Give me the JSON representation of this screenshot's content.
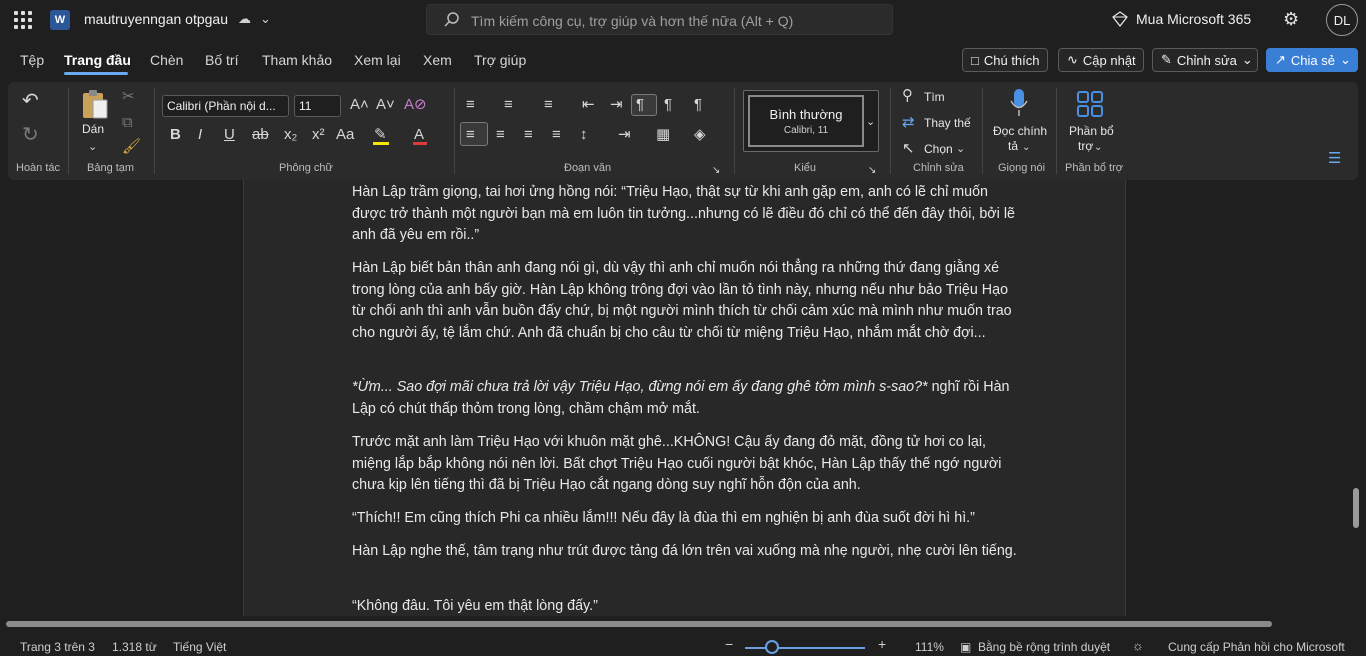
{
  "titlebar": {
    "doc_title": "mautruyenngan otpgau",
    "search_placeholder": "Tìm kiếm công cụ, trợ giúp và hơn thế nữa (Alt + Q)",
    "buy_label": "Mua Microsoft 365",
    "avatar_initials": "DL",
    "app_letter": "W"
  },
  "tabs": [
    "Tệp",
    "Trang đầu",
    "Chèn",
    "Bố trí",
    "Tham khảo",
    "Xem lại",
    "Xem",
    "Trợ giúp"
  ],
  "active_tab": "Trang đầu",
  "top_buttons": {
    "comments": "Chú thích",
    "update": "Cập nhật",
    "editing": "Chỉnh sửa",
    "share": "Chia sẻ"
  },
  "ribbon": {
    "groups": {
      "undo": "Hoàn tác",
      "clipboard": "Bảng tạm",
      "font": "Phông chữ",
      "paragraph": "Đoạn văn",
      "styles": "Kiểu",
      "editing": "Chỉnh sửa",
      "voice": "Giọng nói",
      "addins": "Phần bổ trợ"
    },
    "paste_label": "Dán",
    "font_name": "Calibri (Phần nội d...",
    "font_size": "11",
    "style_name": "Bình thường",
    "style_sub": "Calibri, 11",
    "find_label": "Tìm",
    "replace_label": "Thay thế",
    "select_label": "Chọn",
    "dictate_label_1": "Đọc chính",
    "dictate_label_2": "tả",
    "addins_label_1": "Phần bổ",
    "addins_label_2": "trợ"
  },
  "document": {
    "paragraphs": [
      "Hàn Lập trầm giọng, tai hơi ửng hồng nói: “Triệu Hạo, thật sự từ khi anh gặp em, anh có lẽ chỉ muốn được trở thành một người bạn mà em luôn tin tưởng...nhưng có lẽ điều đó chỉ có thể đến đây thôi, bởi lẽ anh đã yêu em rồi..”",
      "Hàn Lập biết bản thân anh đang nói gì, dù vậy thì anh chỉ muốn nói thẳng ra những thứ đang giằng xé trong lòng của anh bấy giờ. Hàn Lập không trông đợi vào lần tỏ tình này, nhưng nếu như bảo Triệu Hạo từ chối anh thì anh vẫn buồn đấy chứ, bị một người mình thích từ chối cảm xúc mà mình như muốn trao cho người ấy, tệ lắm chứ. Anh đã chuẩn bị cho câu từ chối từ miệng Triệu Hạo, nhắm mắt chờ đợi...",
      "Hàn Lập có chút thấp thỏm trong lòng, chầm chậm mở mắt.",
      "Trước mặt anh làm Triệu Hạo với khuôn mặt ghê...KHÔNG! Cậu ấy đang đỏ mặt, đồng tử hơi co lại, miệng lắp bắp không nói nên lời. Bất chợt Triệu Hạo cuối người bật khóc, Hàn Lập thấy thế ngớ người chưa kịp lên tiếng thì đã bị Triệu Hạo cắt ngang dòng suy nghĩ hỗn độn của anh.",
      "“Thích!! Em cũng thích Phi ca nhiều lắm!!! Nếu đây là đùa thì em nghiện bị anh đùa suốt đời hì hì.”",
      "Hàn Lập nghe thế, tâm trạng như trút được tảng đá lớn trên vai xuống mà nhẹ người, nhẹ cười lên tiếng.",
      "“Không đâu. Tôi yêu em thật lòng đấy.”"
    ],
    "italic_part": "*Ừm... Sao đợi mãi chưa trả lời vậy Triệu Hạo, đừng nói em ấy đang ghê tởm mình s-sao?*",
    "italic_tail": " nghĩ rồi"
  },
  "status": {
    "page": "Trang 3 trên 3",
    "words": "1.318 từ",
    "language": "Tiếng Việt",
    "zoom": "111%",
    "fit": "Bằng bề rộng trình duyệt",
    "feedback": "Cung cấp Phản hồi cho Microsoft"
  }
}
